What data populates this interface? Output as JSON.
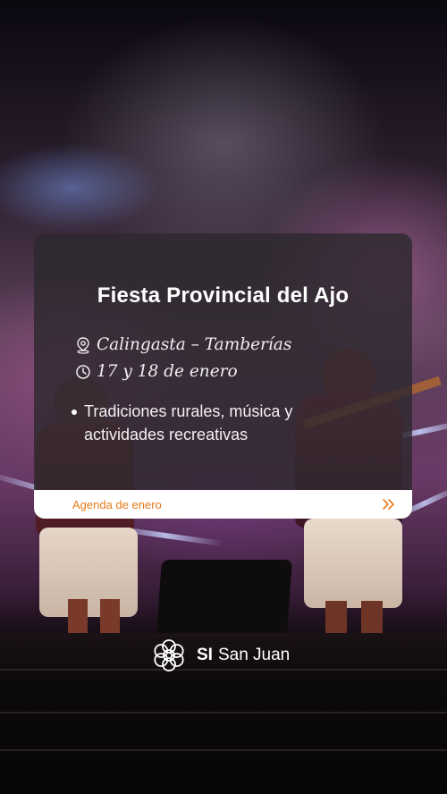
{
  "event": {
    "title": "Fiesta Provincial del Ajo",
    "location": "Calingasta – Tamberías",
    "date": "17 y 18 de enero",
    "description": "Tradiciones rurales, música y actividades recreativas"
  },
  "agenda": {
    "label": "Agenda de enero",
    "arrow_icon": "double-chevron-right-icon"
  },
  "brand": {
    "prefix": "SI",
    "name": "San Juan",
    "logo_icon": "flower-logo-icon"
  },
  "colors": {
    "accent": "#e47a1a",
    "card_bg": "rgba(45,40,46,0.82)",
    "text": "#ffffff"
  }
}
